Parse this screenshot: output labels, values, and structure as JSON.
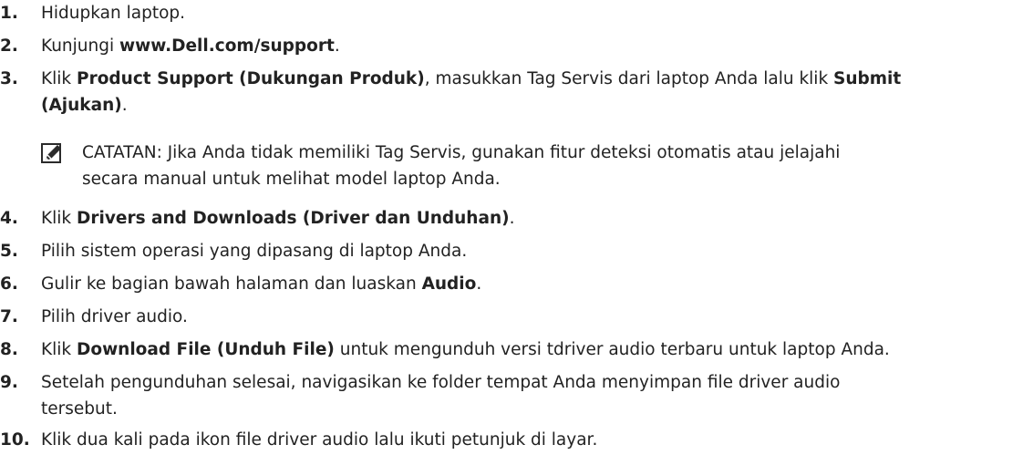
{
  "steps": [
    {
      "number": "1.",
      "parts": [
        {
          "text": "Hidupkan laptop.",
          "bold": false
        }
      ]
    },
    {
      "number": "2.",
      "parts": [
        {
          "text": "Kunjungi ",
          "bold": false
        },
        {
          "text": "www.Dell.com/support",
          "bold": true
        },
        {
          "text": ".",
          "bold": false
        }
      ]
    },
    {
      "number": "3.",
      "parts": [
        {
          "text": "Klik ",
          "bold": false
        },
        {
          "text": "Product Support (Dukungan Produk)",
          "bold": true
        },
        {
          "text": ", masukkan Tag Servis dari laptop Anda lalu klik ",
          "bold": false
        },
        {
          "text": "Submit",
          "bold": true
        }
      ],
      "line2": [
        {
          "text": "(Ajukan)",
          "bold": true
        },
        {
          "text": ".",
          "bold": false
        }
      ]
    },
    {
      "number": "4.",
      "parts": [
        {
          "text": "Klik ",
          "bold": false
        },
        {
          "text": "Drivers and Downloads (Driver dan Unduhan)",
          "bold": true
        },
        {
          "text": ".",
          "bold": false
        }
      ]
    },
    {
      "number": "5.",
      "parts": [
        {
          "text": "Pilih sistem operasi yang dipasang di laptop Anda.",
          "bold": false
        }
      ]
    },
    {
      "number": "6.",
      "parts": [
        {
          "text": "Gulir ke bagian bawah halaman dan luaskan ",
          "bold": false
        },
        {
          "text": "Audio",
          "bold": true
        },
        {
          "text": ".",
          "bold": false
        }
      ]
    },
    {
      "number": "7.",
      "parts": [
        {
          "text": "Pilih driver audio.",
          "bold": false
        }
      ]
    },
    {
      "number": "8.",
      "parts": [
        {
          "text": "Klik ",
          "bold": false
        },
        {
          "text": "Download File (Unduh File)",
          "bold": true
        },
        {
          "text": " untuk mengunduh versi tdriver audio terbaru untuk laptop Anda.",
          "bold": false
        }
      ]
    },
    {
      "number": "9.",
      "parts": [
        {
          "text": "Setelah pengunduhan selesai, navigasikan ke folder tempat Anda menyimpan file driver audio",
          "bold": false
        }
      ],
      "line2": [
        {
          "text": "tersebut.",
          "bold": false
        }
      ]
    },
    {
      "number": "10.",
      "parts": [
        {
          "text": "Klik dua kali pada ikon file driver audio lalu ikuti petunjuk di layar.",
          "bold": false
        }
      ]
    }
  ],
  "note": {
    "icon": "pencil-note-icon",
    "label": "CATATAN:",
    "line1": " Jika Anda tidak memiliki Tag Servis, gunakan fitur deteksi otomatis atau jelajahi",
    "line2": "secara manual untuk melihat model laptop Anda."
  }
}
